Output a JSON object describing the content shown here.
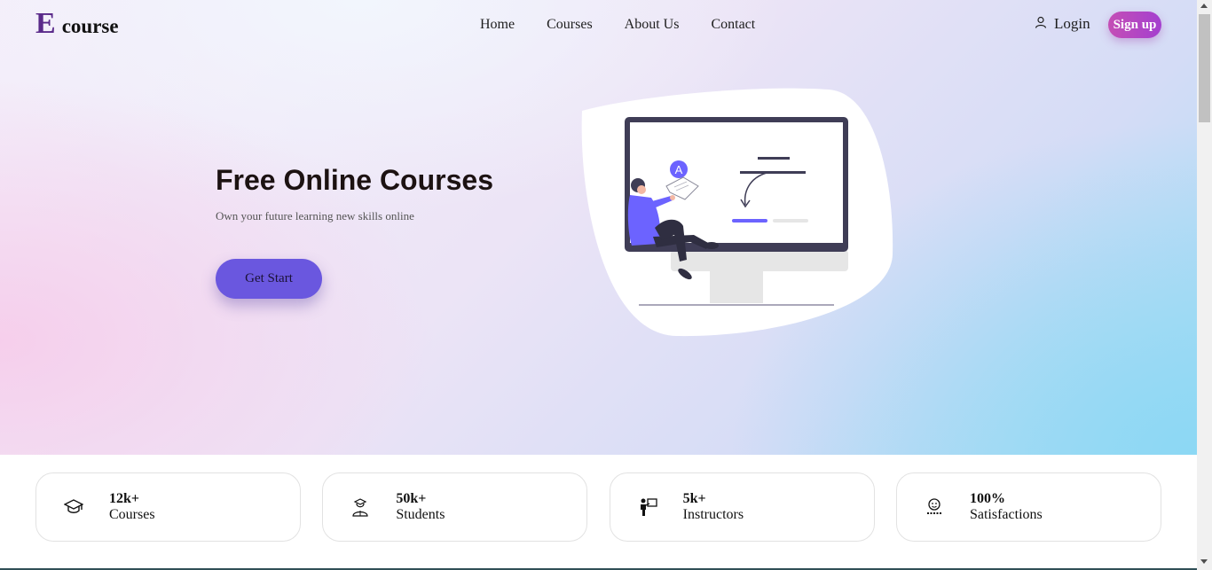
{
  "logo": {
    "letter": "E",
    "text": "course"
  },
  "nav": {
    "items": [
      "Home",
      "Courses",
      "About Us",
      "Contact"
    ]
  },
  "auth": {
    "login": "Login",
    "signup": "Sign up"
  },
  "hero": {
    "title": "Free Online Courses",
    "subtitle": "Own your future learning new skills online",
    "cta": "Get Start",
    "illustration": {
      "avatar_letter": "A"
    }
  },
  "stats": [
    {
      "value": "12k+",
      "label": "Courses",
      "icon": "graduation-cap-icon"
    },
    {
      "value": "50k+",
      "label": "Students",
      "icon": "student-icon"
    },
    {
      "value": "5k+",
      "label": "Instructors",
      "icon": "instructor-icon"
    },
    {
      "value": "100%",
      "label": "Satisfactions",
      "icon": "smiley-icon"
    }
  ],
  "colors": {
    "brand": "#5a2a8a",
    "accent": "#6a57df",
    "signup_gradient_start": "#c44fb5",
    "signup_gradient_end": "#a43fcf"
  }
}
